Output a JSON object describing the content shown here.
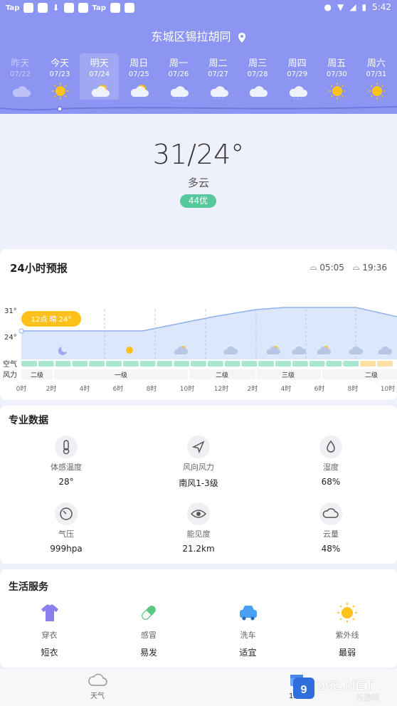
{
  "status": {
    "time": "5:42",
    "tags": [
      "Tap",
      "Tap"
    ]
  },
  "location": "东城区锡拉胡同",
  "days": [
    {
      "name": "昨天",
      "date": "07/22",
      "icon": "cloud-rain-icon"
    },
    {
      "name": "今天",
      "date": "07/23",
      "icon": "sun-icon"
    },
    {
      "name": "明天",
      "date": "07/24",
      "icon": "partly-cloudy-icon"
    },
    {
      "name": "周日",
      "date": "07/25",
      "icon": "partly-cloudy-icon"
    },
    {
      "name": "周一",
      "date": "07/26",
      "icon": "cloud-rain-icon"
    },
    {
      "name": "周二",
      "date": "07/27",
      "icon": "cloud-rain-icon"
    },
    {
      "name": "周三",
      "date": "07/28",
      "icon": "cloud-icon"
    },
    {
      "name": "周四",
      "date": "07/29",
      "icon": "cloud-rain-icon"
    },
    {
      "name": "周五",
      "date": "07/30",
      "icon": "sun-icon"
    },
    {
      "name": "周六",
      "date": "07/31",
      "icon": "sun-icon"
    }
  ],
  "current": {
    "temp": "31/24°",
    "condition": "多云",
    "aqi": "44优"
  },
  "forecast24": {
    "title": "24小时预报",
    "sunrise": "05:05",
    "sunset": "19:36",
    "tooltip": "12点 晴 24°",
    "ymax": "31°",
    "ymin": "24°",
    "air_label": "空气",
    "wind_label": "风力",
    "wind_levels": [
      "二级",
      "一级",
      "二级",
      "三级",
      "二级"
    ],
    "hours": [
      "0时",
      "2时",
      "4时",
      "6时",
      "8时",
      "10时",
      "12时",
      "2时",
      "4时",
      "6时",
      "8时",
      "10时"
    ]
  },
  "pro": {
    "title": "专业数据",
    "items": [
      {
        "label": "体感温度",
        "value": "28°",
        "icon": "thermometer-icon"
      },
      {
        "label": "风向风力",
        "value": "南风1-3级",
        "icon": "wind-direction-icon"
      },
      {
        "label": "湿度",
        "value": "68%",
        "icon": "humidity-icon"
      },
      {
        "label": "气压",
        "value": "999hpa",
        "icon": "pressure-gauge-icon"
      },
      {
        "label": "能见度",
        "value": "21.2km",
        "icon": "eye-icon"
      },
      {
        "label": "云量",
        "value": "48%",
        "icon": "cloud-icon"
      }
    ]
  },
  "life": {
    "title": "生活服务",
    "items": [
      {
        "label": "穿衣",
        "value": "短衣",
        "icon": "shirt-icon"
      },
      {
        "label": "感冒",
        "value": "易发",
        "icon": "pill-icon"
      },
      {
        "label": "洗车",
        "value": "适宜",
        "icon": "car-icon"
      },
      {
        "label": "紫外线",
        "value": "最弱",
        "icon": "uv-sun-icon"
      }
    ]
  },
  "tabs": [
    {
      "label": "天气"
    },
    {
      "label": "15天"
    }
  ],
  "watermark": {
    "brand": "962.NET",
    "sub": "乐游网"
  }
}
